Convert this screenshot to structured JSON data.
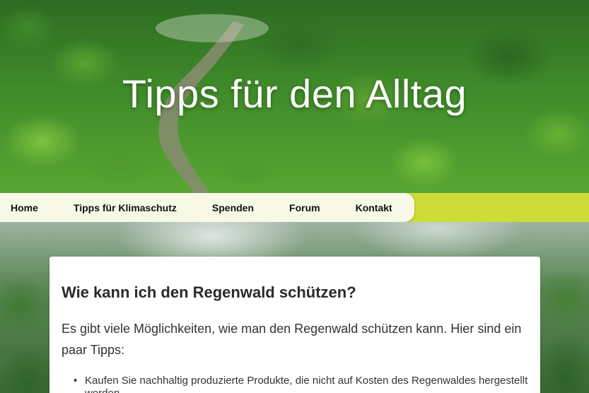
{
  "hero": {
    "title": "Tipps für den Alltag"
  },
  "nav": {
    "items": [
      {
        "label": "Home"
      },
      {
        "label": "Tipps für Klimaschutz"
      },
      {
        "label": "Spenden"
      },
      {
        "label": "Forum"
      },
      {
        "label": "Kontakt"
      }
    ]
  },
  "colors": {
    "accent": "#cddc39",
    "nav_background": "#f7f9e6",
    "card_background": "#ffffff"
  },
  "article": {
    "heading": "Wie kann ich den Regenwald schützen?",
    "intro": "Es gibt viele Möglichkeiten, wie man den Regenwald schützen kann. Hier sind ein paar Tipps:",
    "tips": [
      "Kaufen Sie nachhaltig produzierte Produkte, die nicht auf Kosten des Regenwaldes hergestellt werden."
    ]
  }
}
